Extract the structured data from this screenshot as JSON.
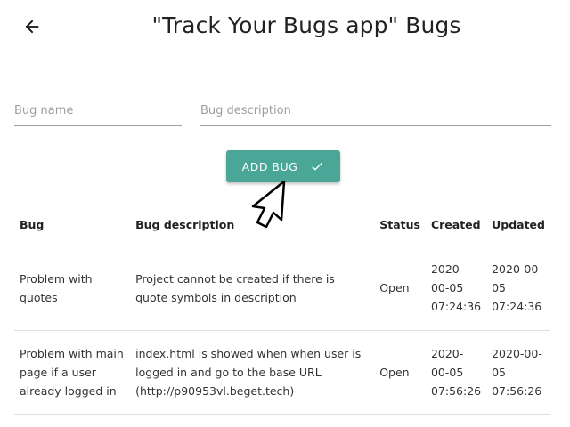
{
  "header": {
    "title": "\"Track Your Bugs app\" Bugs",
    "back_icon": "arrow-left-icon"
  },
  "form": {
    "bug_name_placeholder": "Bug name",
    "bug_description_placeholder": "Bug description",
    "add_button_label": "ADD BUG",
    "add_button_icon": "check-icon"
  },
  "colors": {
    "accent": "#4aa797",
    "divider": "#e0e0e0"
  },
  "table": {
    "columns": [
      "Bug",
      "Bug description",
      "Status",
      "Created",
      "Updated"
    ],
    "rows": [
      {
        "bug": "Problem with quotes",
        "description": "Project cannot be created if there is quote symbols in description",
        "status": "Open",
        "created": "2020-00-05 07:24:36",
        "updated": "2020-00-05 07:24:36"
      },
      {
        "bug": "Problem with main page if a user already logged in",
        "description": "index.html is showed when when user is logged in and go to the base URL (http://p90953vl.beget.tech)",
        "status": "Open",
        "created": "2020-00-05 07:56:26",
        "updated": "2020-00-05 07:56:26"
      }
    ]
  }
}
